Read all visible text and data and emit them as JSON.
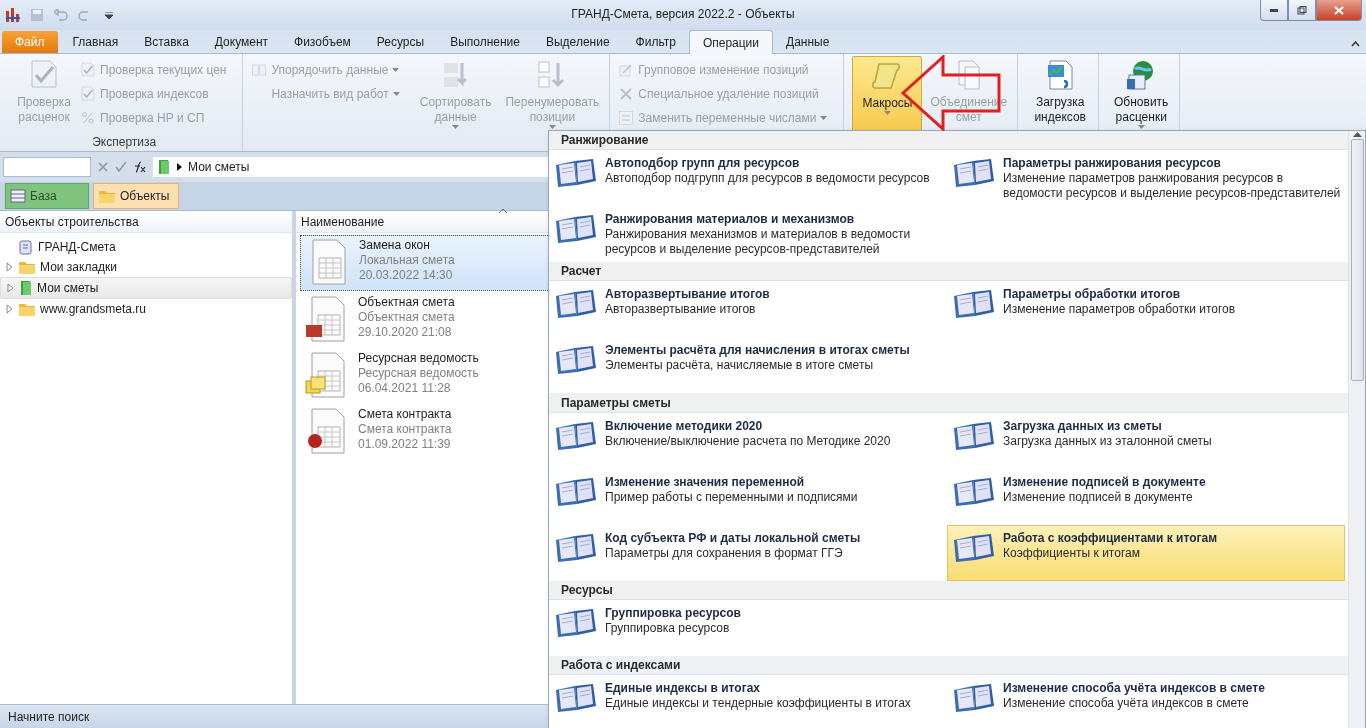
{
  "window": {
    "title": "ГРАНД-Смета, версия 2022.2 - Объекты"
  },
  "ribbon_tabs": [
    {
      "label": "Файл",
      "kind": "file",
      "selected": false
    },
    {
      "label": "Главная",
      "kind": "tab",
      "selected": false
    },
    {
      "label": "Вставка",
      "kind": "tab",
      "selected": false
    },
    {
      "label": "Документ",
      "kind": "tab",
      "selected": false
    },
    {
      "label": "Физобъем",
      "kind": "tab",
      "selected": false
    },
    {
      "label": "Ресурсы",
      "kind": "tab",
      "selected": false
    },
    {
      "label": "Выполнение",
      "kind": "tab",
      "selected": false
    },
    {
      "label": "Выделение",
      "kind": "tab",
      "selected": false
    },
    {
      "label": "Фильтр",
      "kind": "tab",
      "selected": false
    },
    {
      "label": "Операции",
      "kind": "tab",
      "selected": true
    },
    {
      "label": "Данные",
      "kind": "tab",
      "selected": false
    }
  ],
  "ribbon_groups": [
    {
      "label": "Экспертиза",
      "items": [
        {
          "kind": "large",
          "label": "Проверка\nрасценок",
          "disabled": true,
          "dropdown": false,
          "pressed": false
        },
        {
          "kind": "small_stack",
          "entries": [
            {
              "label": "Проверка текущих цен",
              "disabled": true,
              "dropdown": false
            },
            {
              "label": "Проверка индексов",
              "disabled": true,
              "dropdown": false
            },
            {
              "label": "Проверка НР и СП",
              "disabled": true,
              "dropdown": false
            }
          ]
        }
      ]
    },
    {
      "items": [
        {
          "kind": "small_stack",
          "entries": [
            {
              "label": "Упорядочить данные",
              "disabled": true,
              "dropdown": true
            },
            {
              "label": "Назначить вид работ",
              "disabled": true,
              "dropdown": true
            }
          ]
        },
        {
          "kind": "large",
          "label": "Сортировать\nданные",
          "disabled": true,
          "dropdown": true,
          "pressed": false
        },
        {
          "kind": "large",
          "label": "Перенумеровать\nпозиции",
          "disabled": true,
          "dropdown": true,
          "pressed": false
        }
      ]
    },
    {
      "items": [
        {
          "kind": "small_stack",
          "entries": [
            {
              "label": "Групповое изменение позиций",
              "disabled": true,
              "dropdown": false
            },
            {
              "label": "Специальное удаление позиций",
              "disabled": true,
              "dropdown": false
            },
            {
              "label": "Заменить переменные числами",
              "disabled": true,
              "dropdown": true
            }
          ]
        }
      ]
    },
    {
      "items": [
        {
          "kind": "large",
          "label": "Макросы",
          "disabled": false,
          "dropdown": true,
          "pressed": true
        },
        {
          "kind": "large",
          "label": "Объединение\nсмет",
          "disabled": true,
          "dropdown": false,
          "pressed": false
        }
      ]
    },
    {
      "items": [
        {
          "kind": "large",
          "label": "Загрузка\nиндексов",
          "disabled": false,
          "dropdown": false,
          "pressed": false
        }
      ]
    },
    {
      "items": [
        {
          "kind": "large",
          "label": "Обновить\nрасценки",
          "disabled": false,
          "dropdown": true,
          "pressed": false
        }
      ]
    }
  ],
  "formula_bar": {
    "path": "Мои сметы"
  },
  "nav_tabs": [
    {
      "label": "База",
      "selected": false,
      "color": "#7fc47f"
    },
    {
      "label": "Объекты",
      "selected": true,
      "color": "#fde0b0"
    }
  ],
  "tree": {
    "header": "Объекты строительства",
    "items": [
      {
        "label": "ГРАНД-Смета",
        "kind": "root",
        "selected": false
      },
      {
        "label": "Мои закладки",
        "kind": "folder",
        "expanded": false,
        "selected": false
      },
      {
        "label": "Мои сметы",
        "kind": "estimates",
        "expanded": false,
        "selected": true
      },
      {
        "label": "www.grandsmeta.ru",
        "kind": "folder",
        "expanded": false,
        "selected": false
      }
    ]
  },
  "list": {
    "header": "Наименование",
    "items": [
      {
        "title": "Замена окон",
        "type": "Локальная смета",
        "date": "20.03.2022 14:30",
        "kind": "local",
        "selected": true
      },
      {
        "title": "Объектная смета",
        "type": "Объектная смета",
        "date": "29.10.2020 21:08",
        "kind": "object",
        "selected": false
      },
      {
        "title": "Ресурсная ведомость",
        "type": "Ресурсная ведомость",
        "date": "06.04.2021 11:28",
        "kind": "resource",
        "selected": false
      },
      {
        "title": "Смета контракта",
        "type": "Смета контракта",
        "date": "01.09.2022 11:39",
        "kind": "contract",
        "selected": false
      }
    ]
  },
  "macros_menu": {
    "sections": [
      {
        "title": "Ранжирование",
        "items": [
          {
            "title": "Автоподбор групп для ресурсов",
            "description": "Автоподбор подгрупп для ресурсов в ведомости ресурсов",
            "selected": false
          },
          {
            "title": "Параметры ранжирования ресурсов",
            "description": "Изменение параметров ранжирования ресурсов в ведомости ресурсов и выделение ресурсов-представителей",
            "selected": false
          },
          {
            "title": "Ранжирования материалов и механизмов",
            "description": "Ранжирования механизмов и материалов в ведомости ресурсов и выделение ресурсов-представителей",
            "selected": false
          }
        ]
      },
      {
        "title": "Расчет",
        "items": [
          {
            "title": "Авторазвертывание итогов",
            "description": "Авторазвертывание итогов",
            "selected": false
          },
          {
            "title": "Параметры обработки итогов",
            "description": "Изменение параметров обработки итогов",
            "selected": false
          },
          {
            "title": "Элементы расчёта для начисления в итогах сметы",
            "description": "Элементы расчёта, начисляемые в итоге сметы",
            "selected": false
          }
        ]
      },
      {
        "title": "Параметры сметы",
        "items": [
          {
            "title": "Включение методики 2020",
            "description": "Включение/выключение расчета по Методике 2020",
            "selected": false
          },
          {
            "title": "Загрузка данных из сметы",
            "description": "Загрузка данных из эталонной сметы",
            "selected": false
          },
          {
            "title": "Изменение значения переменной",
            "description": "Пример работы с переменными и подписями",
            "selected": false
          },
          {
            "title": "Изменение подписей в документе",
            "description": "Изменение подписей в документе",
            "selected": false
          },
          {
            "title": "Код субъекта РФ и даты локальной сметы",
            "description": "Параметры для сохранения в формат ГГЭ",
            "selected": false
          },
          {
            "title": "Работа с коэффициентами к итогам",
            "description": "Коэффициенты к итогам",
            "selected": true
          }
        ]
      },
      {
        "title": "Ресурсы",
        "items": [
          {
            "title": "Группировка ресурсов",
            "description": "Группировка ресурсов",
            "selected": false
          }
        ]
      },
      {
        "title": "Работа с индексами",
        "items": [
          {
            "title": "Единые индексы в итогах",
            "description": "Единые индексы и тендерные коэффициенты в итогах",
            "selected": false
          },
          {
            "title": "Изменение способа учёта индексов в смете",
            "description": "Изменение способа учёта индексов в смете",
            "selected": false
          }
        ]
      }
    ]
  },
  "status_bar": {
    "text": "Начните поиск"
  }
}
